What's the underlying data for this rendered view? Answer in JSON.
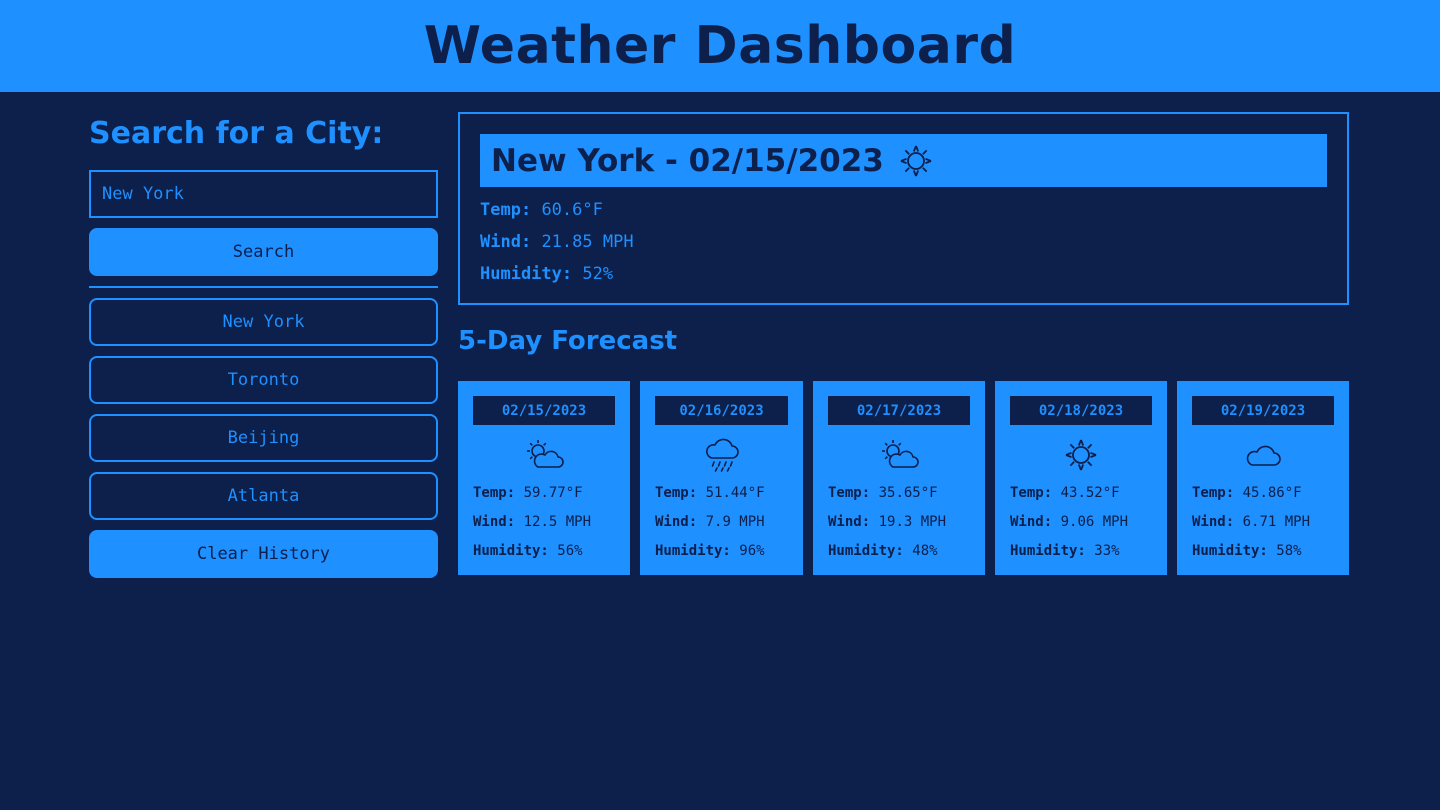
{
  "header": {
    "title": "Weather Dashboard"
  },
  "sidebar": {
    "heading": "Search for a City:",
    "search_value": "New York",
    "search_button": "Search",
    "history": [
      "New York",
      "Toronto",
      "Beijing",
      "Atlanta"
    ],
    "clear_button": "Clear History"
  },
  "current": {
    "title": "New York - 02/15/2023",
    "icon": "sun-icon",
    "temp_label": "Temp:",
    "temp": "60.6°F",
    "wind_label": "Wind:",
    "wind": "21.85 MPH",
    "humidity_label": "Humidity:",
    "humidity": "52%"
  },
  "forecast": {
    "title": "5-Day Forecast",
    "labels": {
      "temp": "Temp:",
      "wind": "Wind:",
      "humidity": "Humidity:"
    },
    "days": [
      {
        "date": "02/15/2023",
        "icon": "partly-cloudy-icon",
        "temp": "59.77°F",
        "wind": "12.5 MPH",
        "humidity": "56%"
      },
      {
        "date": "02/16/2023",
        "icon": "rain-icon",
        "temp": "51.44°F",
        "wind": "7.9 MPH",
        "humidity": "96%"
      },
      {
        "date": "02/17/2023",
        "icon": "partly-cloudy-icon",
        "temp": "35.65°F",
        "wind": "19.3 MPH",
        "humidity": "48%"
      },
      {
        "date": "02/18/2023",
        "icon": "sun-icon",
        "temp": "43.52°F",
        "wind": "9.06 MPH",
        "humidity": "33%"
      },
      {
        "date": "02/19/2023",
        "icon": "cloud-icon",
        "temp": "45.86°F",
        "wind": "6.71 MPH",
        "humidity": "58%"
      }
    ]
  },
  "colors": {
    "background": "#0d1f4b",
    "accent": "#1e90ff"
  }
}
